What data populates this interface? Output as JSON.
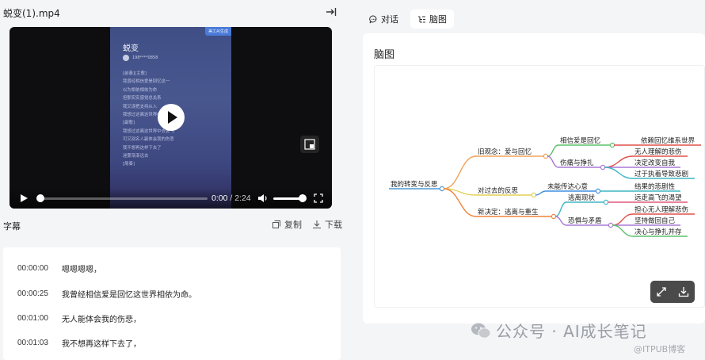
{
  "file": {
    "title": "蜕变(1).mp4"
  },
  "video": {
    "poster_badge": "美工AI生成",
    "poster_title": "蜕变",
    "poster_author": "198****0858",
    "poster_lines": [
      "[前奏][主歌]",
      "我曾经相信爱是回忆这一",
      "以为相依相依为命",
      "但那实实感觉总关系",
      "我又误把支持从入",
      "我想过这离这世界中去说飞",
      "[副歌]",
      "我想过这离这世界中去说飞",
      "可又别名人副体会我的伤悲",
      "我不想再这样下去了",
      "迷雾渐渐远去",
      "[尾奏]"
    ],
    "time_current": "0:00",
    "time_duration": "2:24",
    "progress": 0,
    "volume": 0.9
  },
  "subtitles": {
    "heading": "字幕",
    "copy_label": "复制",
    "download_label": "下载",
    "rows": [
      {
        "time": "00:00:00",
        "text": "嗯嗯嗯嗯，"
      },
      {
        "time": "00:00:25",
        "text": "我曾经相信爱是回忆这世界相依为命。"
      },
      {
        "time": "00:01:00",
        "text": "无人能体会我的伤悲，"
      },
      {
        "time": "00:01:03",
        "text": "我不想再这样下去了，"
      }
    ]
  },
  "tabs": [
    {
      "label": "对话",
      "icon": "chat-icon",
      "active": false
    },
    {
      "label": "脑图",
      "icon": "mindmap-icon",
      "active": true
    }
  ],
  "mindmap": {
    "title": "脑图",
    "root": "我的转变与反思",
    "branches": [
      {
        "label": "旧观念：爱与回忆",
        "color": "#f4a35c",
        "children": [
          {
            "label": "相信爱是回忆",
            "color": "#5bc06a",
            "children": [
              "依赖回忆维系世界"
            ],
            "leaf_colors": [
              "#e0504a"
            ]
          },
          {
            "label": "伤痛与挣扎",
            "color": "#a978d6",
            "children": [
              "无人理解的悲伤",
              "决定改变自我",
              "过于执着导致悲剧"
            ],
            "leaf_colors": [
              "#e0504a",
              "#a978d6",
              "#3fb6c4"
            ]
          }
        ]
      },
      {
        "label": "对过去的反思",
        "color": "#e3d155",
        "children": [
          {
            "label": "未能传达心意",
            "color": "#3f8fe0",
            "children": [
              "结果的悲剧性"
            ],
            "leaf_colors": [
              "#3fb6c4"
            ]
          }
        ]
      },
      {
        "label": "新决定：逃离与重生",
        "color": "#f0843c",
        "children": [
          {
            "label": "逃离现状",
            "color": "#3fb6c4",
            "children": [
              "远走高飞的渴望"
            ],
            "leaf_colors": [
              "#e05a7a"
            ]
          },
          {
            "label": "恐惧与矛盾",
            "color": "#a978d6",
            "children": [
              "担心无人理解悲伤",
              "坚持做回自己",
              "决心与挣扎并存"
            ],
            "leaf_colors": [
              "#e0504a",
              "#a978d6",
              "#5bc06a"
            ]
          }
        ]
      }
    ]
  },
  "watermark": {
    "main": "公众号 · AI成长笔记",
    "sub": "@ITPUB博客"
  }
}
